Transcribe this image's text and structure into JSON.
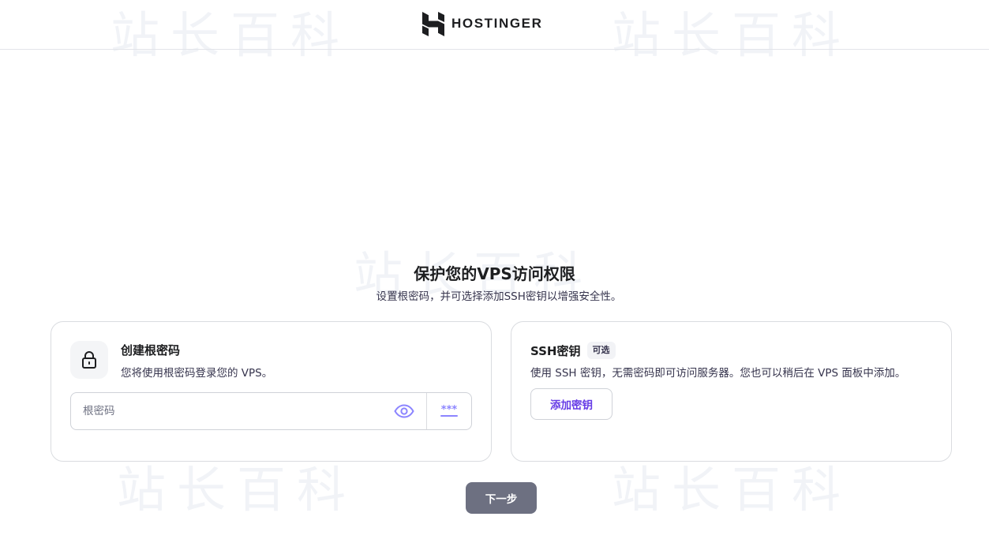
{
  "brand": {
    "name": "HOSTINGER",
    "logo_icon": "hostinger-h-logo"
  },
  "watermark": {
    "text": "站长百科"
  },
  "heading": {
    "title": "保护您的VPS访问权限",
    "subtitle": "设置根密码，并可选择添加SSH密钥以增强安全性。"
  },
  "root_password_card": {
    "icon": "lock-icon",
    "title": "创建根密码",
    "description": "您将使用根密码登录您的 VPS。",
    "input": {
      "placeholder": "根密码",
      "value": ""
    },
    "toggle_visibility_icon": "eye-icon",
    "generate_password_icon": "password-dots-icon"
  },
  "ssh_key_card": {
    "title": "SSH密钥",
    "badge": "可选",
    "description": "使用 SSH 密钥，无需密码即可访问服务器。您也可以稍后在 VPS 面板中添加。",
    "add_button_label": "添加密钥"
  },
  "footer": {
    "next_button_label": "下一步"
  },
  "colors": {
    "accent_purple": "#673de6",
    "icon_purple": "#8c85ff",
    "next_button_bg": "#6d7081",
    "border": "#dadce0",
    "text_primary": "#1d1e20",
    "text_secondary": "#36344d"
  }
}
